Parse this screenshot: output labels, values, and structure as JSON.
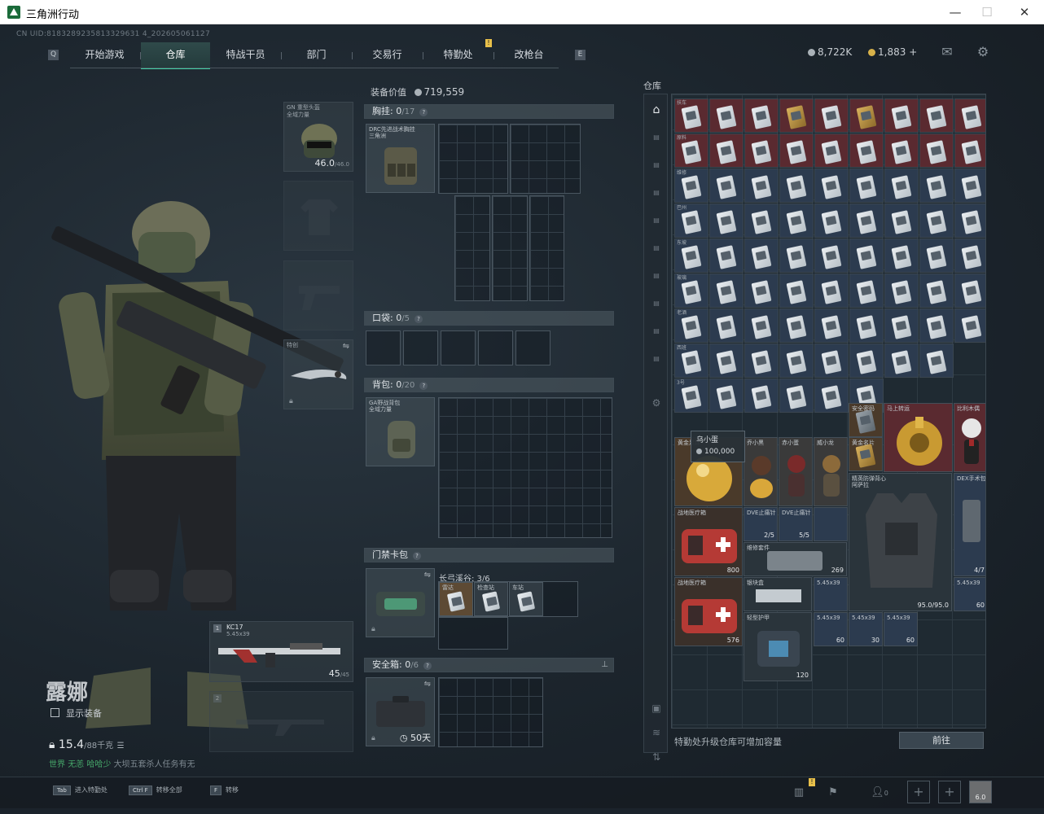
{
  "window": {
    "title": "三角洲行动"
  },
  "uid": "CN UID:8183289235813329631 4_202605061127",
  "nav": {
    "tabs": [
      "开始游戏",
      "仓库",
      "特战干员",
      "部门",
      "交易行",
      "特勤处",
      "改枪台"
    ],
    "active": "仓库"
  },
  "currency": {
    "coins": "8,722K",
    "gold": "1,883",
    "plus": "+"
  },
  "loadout": {
    "helmet": {
      "label": "GN 重型头盔\n全域力量",
      "durability": "46.0",
      "max": "/46.0"
    },
    "melee": {
      "label": "特创"
    },
    "primary": {
      "slot": "1",
      "name": "KC17",
      "ammo_type": "5.45x39",
      "ammo": "45",
      "ammo_max": "/45"
    },
    "secondary": {
      "slot": "2"
    }
  },
  "agent": {
    "name": "露娜",
    "show_equip": "显示装备",
    "weight": "15.4",
    "weight_max": "/88千克"
  },
  "chat": {
    "channel": "世界",
    "user": "无恙",
    "user2": "哈哈少",
    "text": "大坝五套杀人任务有无"
  },
  "center": {
    "value_label": "装备价值",
    "value": "719,559",
    "chest": {
      "title": "胸挂:",
      "count": "0",
      "total": "/17",
      "item": "DRC先进战术胸挂\n三角洲"
    },
    "pocket": {
      "title": "口袋:",
      "count": "0",
      "total": "/5"
    },
    "backpack": {
      "title": "背包:",
      "count": "0",
      "total": "/20",
      "item": "GA野战背包\n全域力量"
    },
    "keycard": {
      "title": "门禁卡包",
      "location": "长弓溪谷: 3/6",
      "cards": [
        "雷达",
        "检查站",
        "车站"
      ]
    },
    "safe": {
      "title": "安全箱:",
      "count": "0",
      "total": "/6",
      "days": "50天"
    }
  },
  "warehouse": {
    "title": "仓库",
    "tooltip_name": "乌小蛋",
    "tooltip_value": "100,000",
    "footer_tip": "特勤处升级仓库可增加容量",
    "goto": "前往",
    "row_labels": [
      "扶车",
      "原料",
      "维修",
      "巴州",
      "东坡",
      "玻璃",
      "老酒",
      "西班",
      "3号"
    ],
    "items": {
      "gold_ball": "黄金足球",
      "figure1": "乔小黑",
      "figure2": "赤小蛋",
      "figure3": "威小龙",
      "card_item": "黄金名片",
      "gem": "安全密码",
      "disc": "马上转运",
      "doll": "比利木偶",
      "medkit1": "战地医疗箱",
      "medkit1_num": "800",
      "medkit2": "战地医疗箱",
      "medkit2_num": "576",
      "inj1": "DVE止痛针",
      "inj1_num": "2/5",
      "inj2": "DVE止痛针",
      "inj2_num": "5/5",
      "vest_label": "精英防弹背心\n阿萨拉",
      "vest_num": "95.0/95.0",
      "fix": "维修套件",
      "fix_num": "269",
      "kit_num": "4/7",
      "dex": "DEX手术包",
      "ammo": "5.45x39",
      "ammo_num": "60",
      "ammo_num2": "30",
      "plate": "轻型护甲",
      "armor_kit": "120",
      "silver": "银块盒"
    }
  },
  "bottom": {
    "hints": [
      {
        "key": "Tab",
        "text": "进入特勤处"
      },
      {
        "key": "Ctrl F",
        "text": "转移全部"
      },
      {
        "key": "F",
        "text": "转移"
      }
    ],
    "friends": "0",
    "avatar_num": "6.0"
  },
  "colors": {
    "accent": "#3fd3a6",
    "red_cell": "#5a2a30",
    "blue_cell": "#2c3b4f"
  }
}
